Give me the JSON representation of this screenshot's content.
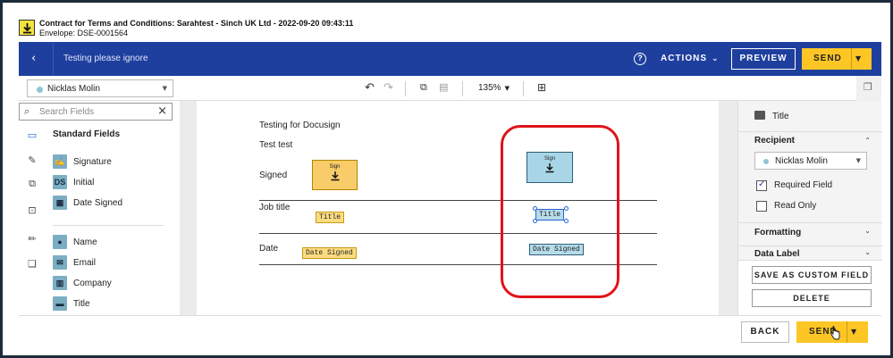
{
  "header": {
    "title": "Contract for Terms and Conditions: Sarahtest - Sinch UK Ltd - 2022-09-20 09:43:11",
    "envelope": "Envelope: DSE-0001564",
    "download_icon": "download-icon"
  },
  "topbar": {
    "back_icon": "chevron-left-icon",
    "title": "Testing please ignore",
    "help_icon": "help-circle-icon",
    "actions_label": "ACTIONS",
    "preview_label": "PREVIEW",
    "send_label": "SEND",
    "accent_color": "#1f3f9f",
    "send_color": "#fdc625"
  },
  "toolbar": {
    "recipient": "Nicklas Molin",
    "zoom": "135%",
    "icons": [
      "undo-icon",
      "redo-icon",
      "copy-icon",
      "paste-icon",
      "comment-icon",
      "pages-icon"
    ]
  },
  "left_panel": {
    "search_placeholder": "Search Fields",
    "section_title": "Standard Fields",
    "fields": [
      {
        "label": "Signature",
        "icon": "signature-icon"
      },
      {
        "label": "Initial",
        "icon": "DS"
      },
      {
        "label": "Date Signed",
        "icon": "calendar-icon"
      },
      {
        "label": "Name",
        "icon": "person-icon"
      },
      {
        "label": "Email",
        "icon": "envelope-icon"
      },
      {
        "label": "Company",
        "icon": "building-icon"
      },
      {
        "label": "Title",
        "icon": "briefcase-icon"
      }
    ]
  },
  "document": {
    "line1": "Testing for Docusign",
    "line2": "Test test",
    "signed_label": "Signed",
    "job_title_label": "Job title",
    "date_label": "Date",
    "sign_tag_label": "Sign",
    "title_tag": "Title",
    "date_signed_tag": "Date Signed",
    "tag_color_yellow": "#fcdc82",
    "tag_color_blue": "#b6dcea",
    "highlight_color": "#e0121b"
  },
  "right_panel": {
    "field_title": "Title",
    "recipient_section": "Recipient",
    "recipient": "Nicklas Molin",
    "required_label": "Required Field",
    "required_checked": true,
    "readonly_label": "Read Only",
    "readonly_checked": false,
    "formatting_section": "Formatting",
    "data_label_section": "Data Label",
    "save_custom_label": "SAVE AS CUSTOM FIELD",
    "delete_label": "DELETE"
  },
  "footer": {
    "back_label": "BACK",
    "send_label": "SEND"
  }
}
